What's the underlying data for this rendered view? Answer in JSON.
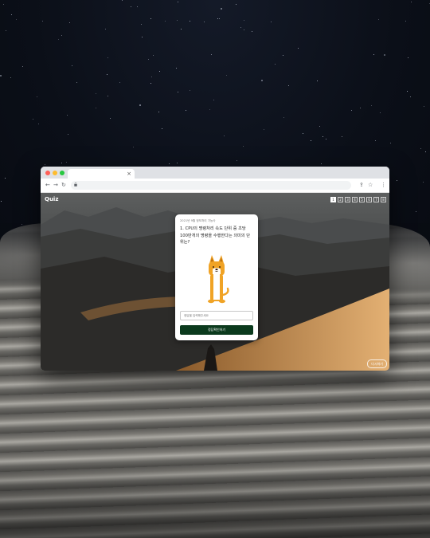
{
  "browser": {
    "tab_close": "×",
    "toolbar": {
      "back": "←",
      "forward": "→",
      "reload": "↻",
      "lock": "🔒",
      "share": "⇪",
      "bookmark": "☆",
      "menu": "⋮"
    }
  },
  "page": {
    "logo": "Quiz",
    "pager": [
      "1",
      "2",
      "3",
      "4",
      "5",
      "6",
      "7",
      "8"
    ],
    "active_page": "1",
    "corner_button": "다시하기"
  },
  "quiz": {
    "meta": "2021년 9월 정보처리 기능사",
    "question": "1. CPU의 명령처리 속도 단위 중 초당 100만개의 명령을 수행한다는 의미의 단위는?",
    "answer_placeholder": "정답을 입력해주세요",
    "submit_label": "정답확인하기"
  },
  "colors": {
    "submit_bg": "#0b3a1d",
    "dog_body": "#f0a325",
    "dog_face": "#ffffff"
  },
  "icons": [
    "back-arrow-icon",
    "forward-arrow-icon",
    "reload-icon",
    "lock-icon",
    "share-icon",
    "bookmark-star-icon",
    "kebab-menu-icon",
    "close-icon"
  ]
}
